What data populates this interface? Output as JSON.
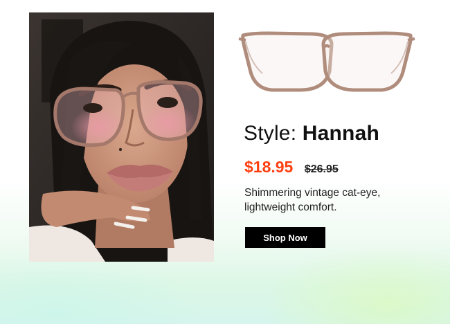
{
  "product": {
    "style_prefix": "Style: ",
    "style_name": "Hannah",
    "price_current": "$18.95",
    "price_original": "$26.95",
    "description": "Shimmering vintage cat-eye, lightweight comfort.",
    "cta_label": "Shop Now"
  },
  "images": {
    "model_photo": "woman-wearing-glasses-photo",
    "product_photo": "translucent-brown-eyeglasses-icon"
  },
  "colors": {
    "price_accent": "#ff3f0f",
    "button_bg": "#000000",
    "button_text": "#ffffff",
    "frame_color": "#b08c7c"
  }
}
